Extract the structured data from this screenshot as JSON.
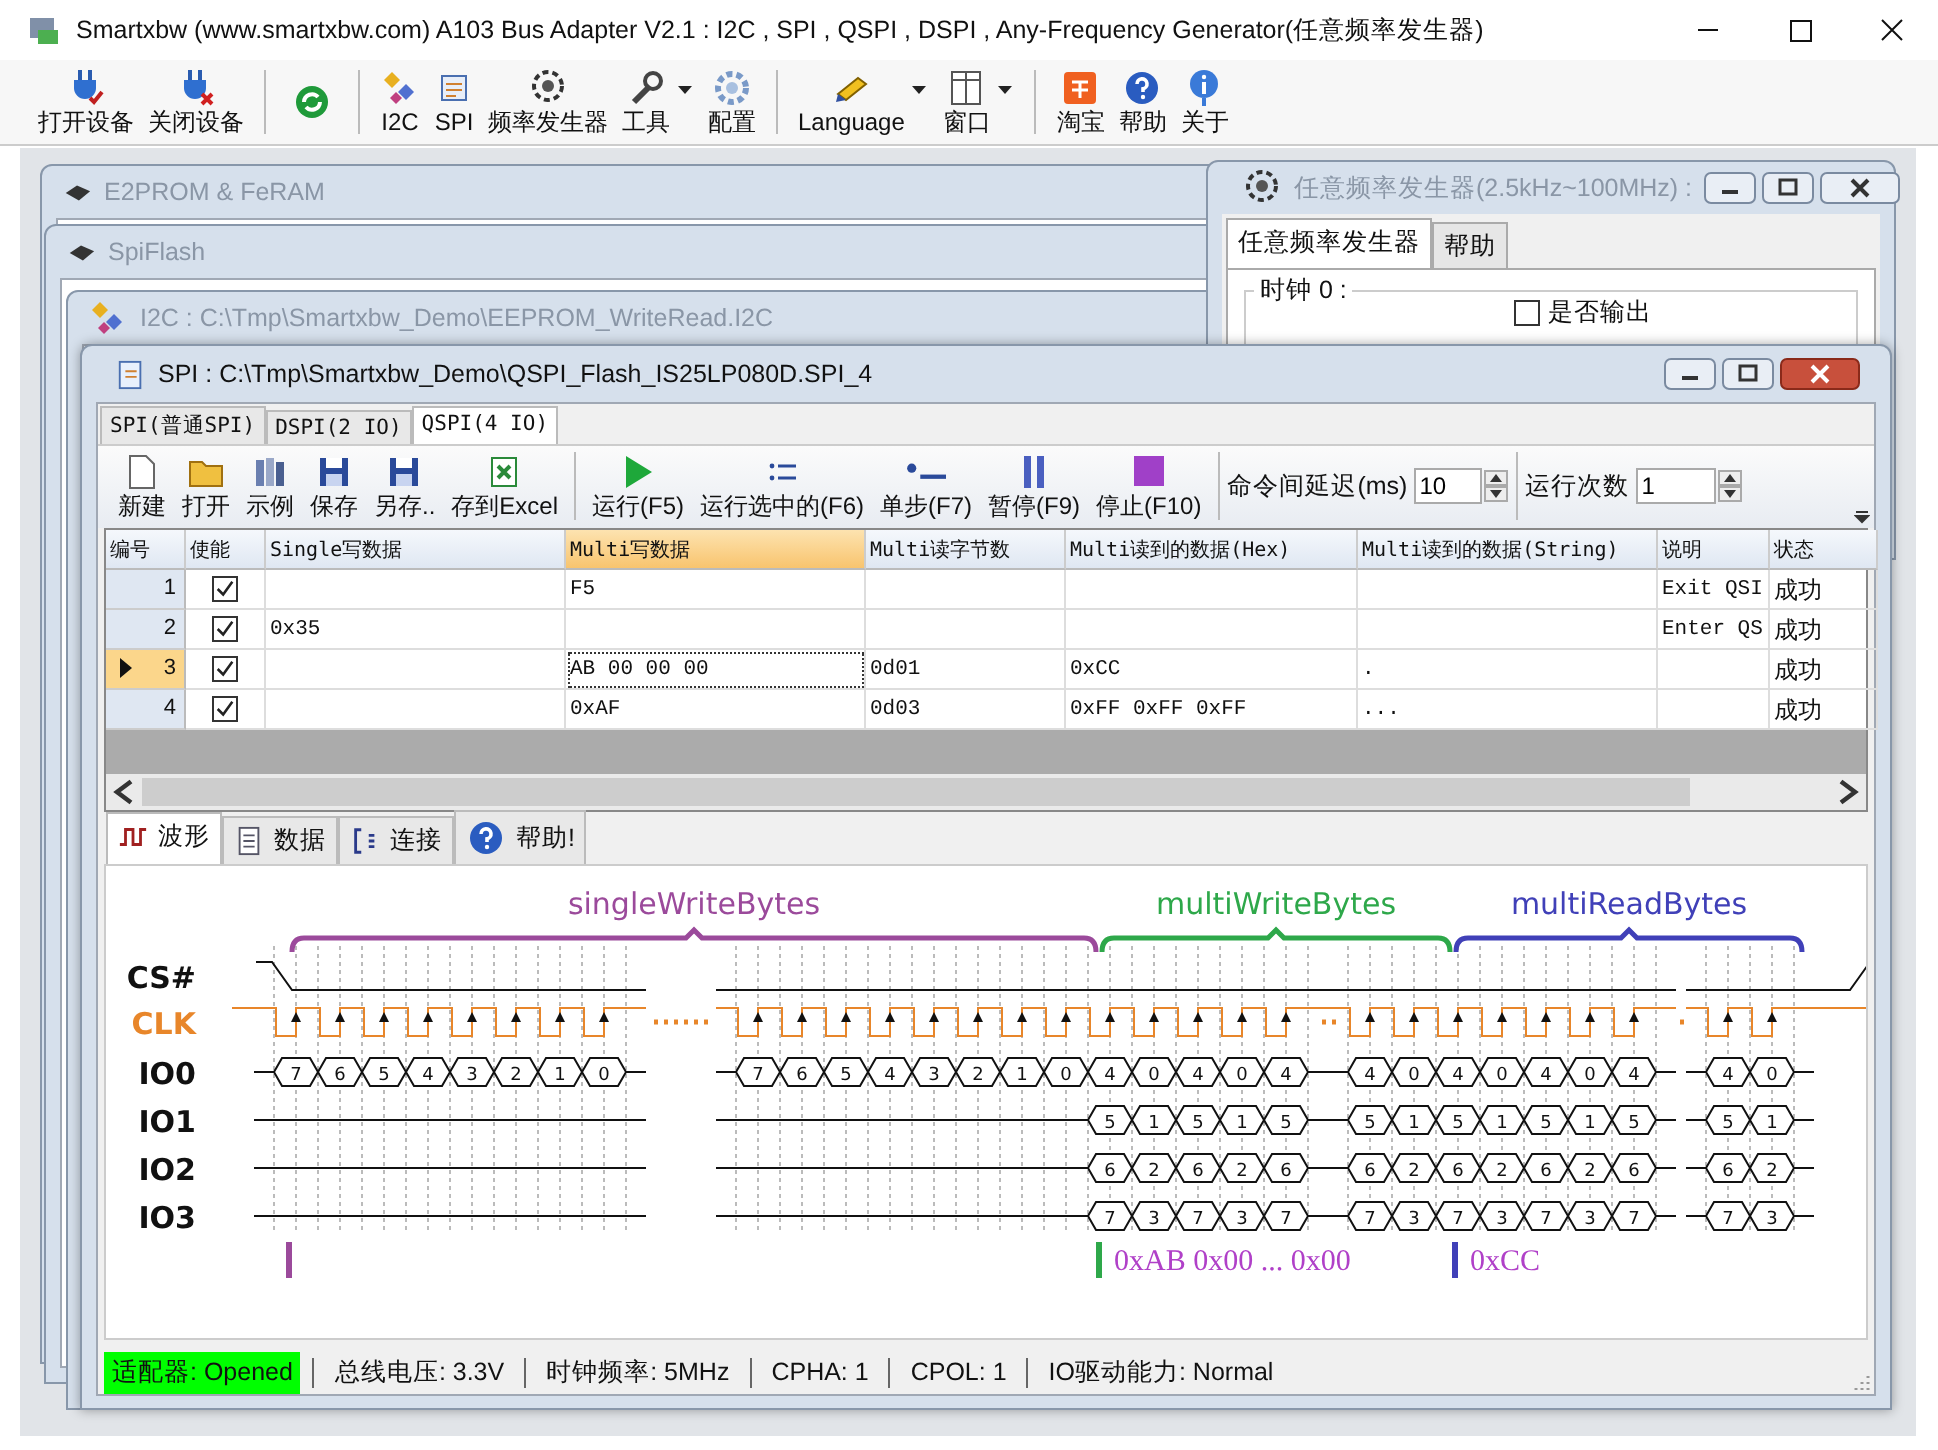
{
  "window": {
    "title": "Smartxbw (www.smartxbw.com) A103 Bus Adapter V2.1 : I2C , SPI , QSPI , DSPI , Any-Frequency Generator(任意频率发生器)"
  },
  "toolbar": [
    {
      "kind": "button",
      "label": "打开设备",
      "menu": false
    },
    {
      "kind": "button",
      "label": "关闭设备",
      "menu": false
    },
    {
      "kind": "separator"
    },
    {
      "kind": "icon-button"
    },
    {
      "kind": "separator"
    },
    {
      "kind": "button",
      "label": "I2C",
      "menu": false
    },
    {
      "kind": "button",
      "label": "SPI",
      "menu": false
    },
    {
      "kind": "button",
      "label": "频率发生器",
      "menu": false
    },
    {
      "kind": "button",
      "label": "工具",
      "menu": true
    },
    {
      "kind": "button",
      "label": "配置",
      "menu": false
    },
    {
      "kind": "separator"
    },
    {
      "kind": "button",
      "label": "Language",
      "menu": true
    },
    {
      "kind": "button",
      "label": "窗口",
      "menu": true
    },
    {
      "kind": "separator"
    },
    {
      "kind": "button",
      "label": "淘宝",
      "menu": false
    },
    {
      "kind": "button",
      "label": "帮助",
      "menu": false
    },
    {
      "kind": "button",
      "label": "关于",
      "menu": false
    }
  ],
  "background_windows": [
    {
      "title": "E2PROM & FeRAM"
    },
    {
      "title": "SpiFlash"
    },
    {
      "title": "I2C : C:\\Tmp\\Smartxbw_Demo\\EEPROM_WriteRead.I2C"
    }
  ],
  "frequency_window": {
    "title": "任意频率发生器(2.5kHz~100MHz) :",
    "tabs": [
      {
        "label": "任意频率发生器",
        "selected": true
      },
      {
        "label": "帮助",
        "selected": false
      }
    ],
    "group_label": "时钟 0 :",
    "output_checkbox": {
      "label": "是否输出",
      "checked": false
    }
  },
  "spi_window": {
    "title": "SPI : C:\\Tmp\\Smartxbw_Demo\\QSPI_Flash_IS25LP080D.SPI_4",
    "mode_tabs": [
      {
        "label": "SPI(普通SPI)",
        "selected": false
      },
      {
        "label": "DSPI(2 IO)",
        "selected": false
      },
      {
        "label": "QSPI(4 IO)",
        "selected": true
      }
    ],
    "toolbar": [
      {
        "label": "新建"
      },
      {
        "label": "打开"
      },
      {
        "label": "示例"
      },
      {
        "label": "保存"
      },
      {
        "label": "另存.."
      },
      {
        "label": "存到Excel"
      },
      {
        "label": "运行(F5)"
      },
      {
        "label": "运行选中的(F6)"
      },
      {
        "label": "单步(F7)"
      },
      {
        "label": "暂停(F9)"
      },
      {
        "label": "停止(F10)"
      }
    ],
    "delay": {
      "label": "命令间延迟(ms)",
      "value": "10"
    },
    "repeat": {
      "label": "运行次数",
      "value": "1"
    },
    "table": {
      "columns": [
        {
          "label": "编号",
          "selected": false
        },
        {
          "label": "使能",
          "selected": false
        },
        {
          "label": "Single写数据",
          "selected": false
        },
        {
          "label": "Multi写数据",
          "selected": true
        },
        {
          "label": "Multi读字节数",
          "selected": false
        },
        {
          "label": "Multi读到的数据(Hex)",
          "selected": false
        },
        {
          "label": "Multi读到的数据(String)",
          "selected": false
        },
        {
          "label": "说明",
          "selected": false
        },
        {
          "label": "状态",
          "selected": false
        }
      ],
      "rows": [
        {
          "number": "1",
          "enabled": true,
          "selected": false,
          "multi_write": "F5",
          "note": "Exit QSI",
          "status": "成功"
        },
        {
          "number": "2",
          "enabled": true,
          "selected": false,
          "single_write": "0x35",
          "note": "Enter QS",
          "status": "成功"
        },
        {
          "number": "3",
          "enabled": true,
          "selected": true,
          "multi_write": "AB 00 00 00",
          "read_count": "0d01",
          "read_hex": "0xCC",
          "read_string": ".",
          "status": "成功"
        },
        {
          "number": "4",
          "enabled": true,
          "selected": false,
          "multi_write": "0xAF",
          "read_count": "0d03",
          "read_hex": "0xFF 0xFF 0xFF",
          "read_string": "...",
          "status": "成功"
        }
      ]
    },
    "view_tabs": [
      {
        "label": "波形",
        "selected": true
      },
      {
        "label": "数据",
        "selected": false
      },
      {
        "label": "连接",
        "selected": false
      },
      {
        "label": "帮助!",
        "selected": false
      }
    ],
    "waveform": {
      "signals": [
        {
          "label": "CS#",
          "color": "#111111"
        },
        {
          "label": "CLK",
          "color": "#e8862a"
        },
        {
          "label": "IO0",
          "color": "#111111"
        },
        {
          "label": "IO1",
          "color": "#111111"
        },
        {
          "label": "IO2",
          "color": "#111111"
        },
        {
          "label": "IO3",
          "color": "#111111"
        }
      ],
      "groups": [
        {
          "label": "singleWriteBytes",
          "color": "#9b4a9b"
        },
        {
          "label": "multiWriteBytes",
          "color": "#2ea84a"
        },
        {
          "label": "multiReadBytes",
          "color": "#4040b8"
        }
      ],
      "segments": [
        {
          "io0": [
            "7",
            "6",
            "5",
            "4",
            "3",
            "2",
            "1",
            "0"
          ]
        },
        {
          "io0": [
            "7",
            "6",
            "5",
            "4",
            "3",
            "2",
            "1",
            "0",
            "4",
            "0",
            "4",
            "0",
            "4"
          ],
          "io1": [
            "5",
            "1",
            "5",
            "1",
            "5"
          ],
          "io2": [
            "6",
            "2",
            "6",
            "2",
            "6"
          ],
          "io3": [
            "7",
            "3",
            "7",
            "3",
            "7"
          ]
        },
        {
          "io0": [
            "4",
            "0",
            "4",
            "0",
            "4",
            "0",
            "4"
          ],
          "io1": [
            "5",
            "1",
            "5",
            "1",
            "5",
            "1",
            "5"
          ],
          "io2": [
            "6",
            "2",
            "6",
            "2",
            "6",
            "2",
            "6"
          ],
          "io3": [
            "7",
            "3",
            "7",
            "3",
            "7",
            "3",
            "7"
          ]
        },
        {
          "io0": [
            "4",
            "0"
          ],
          "io1": [
            "5",
            "1"
          ],
          "io2": [
            "6",
            "2"
          ],
          "io3": [
            "7",
            "3"
          ]
        }
      ],
      "markers": [
        {
          "color": "#9b4a9b"
        },
        {
          "color": "#2ea84a",
          "text": "0xAB 0x00 ... 0x00"
        },
        {
          "color": "#4040b8",
          "text": "0xCC"
        }
      ]
    }
  },
  "status_bar": {
    "adapter": {
      "text": "适配器: Opened",
      "connected": true
    },
    "items": [
      "总线电压: 3.3V",
      "时钟频率: 5MHz",
      "CPHA: 1",
      "CPOL: 1",
      "IO驱动能力: Normal"
    ]
  }
}
